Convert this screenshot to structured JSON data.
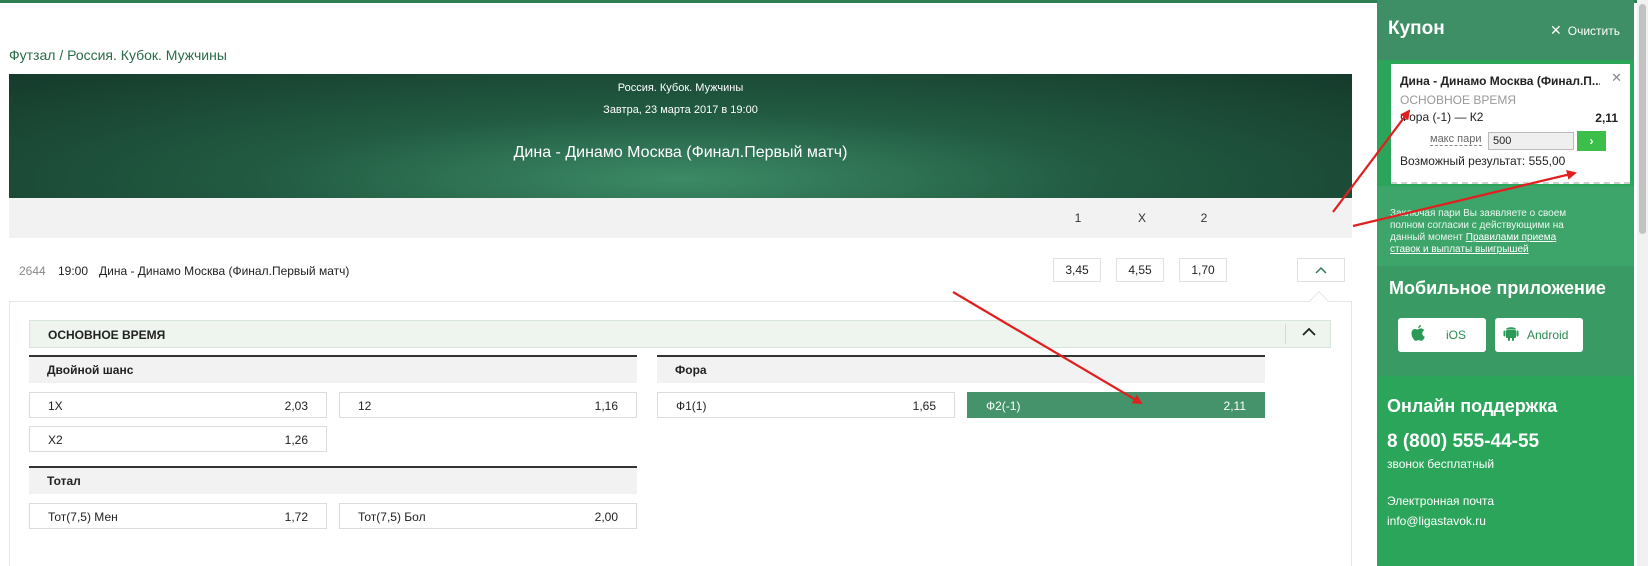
{
  "breadcrumb": "Футзал / Россия. Кубок. Мужчины",
  "banner": {
    "league": "Россия. Кубок. Мужчины",
    "date": "Завтра, 23 марта 2017 в 19:00",
    "title": "Дина - Динамо Москва (Финал.Первый матч)"
  },
  "columns": [
    "1",
    "X",
    "2"
  ],
  "event": {
    "number": "2644",
    "time": "19:00",
    "name": "Дина - Динамо Москва (Финал.Первый матч)",
    "odds": [
      "3,45",
      "4,55",
      "1,70"
    ],
    "collapse_icon": "chevron-up-icon"
  },
  "period": {
    "label": "ОСНОВНОЕ ВРЕМЯ",
    "toggle_icon": "chevron-up-icon"
  },
  "markets": {
    "double_chance": {
      "title": "Двойной шанс",
      "cells": [
        {
          "name": "1X",
          "value": "2,03"
        },
        {
          "name": "12",
          "value": "1,16"
        },
        {
          "name": "X2",
          "value": "1,26"
        }
      ]
    },
    "handicap": {
      "title": "Фора",
      "cells": [
        {
          "name": "Ф1(1)",
          "value": "1,65"
        },
        {
          "name": "Ф2(-1)",
          "value": "2,11",
          "selected": true
        }
      ]
    },
    "total": {
      "title": "Тотал",
      "cells": [
        {
          "name": "Тот(7,5) Мен",
          "value": "1,72"
        },
        {
          "name": "Тот(7,5) Бол",
          "value": "2,00"
        }
      ]
    }
  },
  "coupon": {
    "title": "Купон",
    "clear_label": "Очистить",
    "match": "Дина - Динамо Москва (Финал.П...",
    "period": "ОСНОВНОЕ ВРЕМЯ",
    "market": "Фора (-1) — К2",
    "odd": "2,11",
    "max_label": "макс пари",
    "stake": "500",
    "go_icon": "chevron-right-icon",
    "result": "Возможный результат: 555,00",
    "terms_text": "Заключая пари Вы заявляете о своем полном согласии с действующими на данный момент ",
    "terms_link": "Правилами приема ставок и выплаты выигрышей"
  },
  "mobile": {
    "title": "Мобильное приложение",
    "ios_label": "iOS",
    "android_label": "Android"
  },
  "support": {
    "title": "Онлайн поддержка",
    "phone": "8 (800) 555-44-55",
    "phone_note": "звонок бесплатный",
    "email_label": "Электронная почта",
    "email": "info@ligastavok.ru"
  },
  "colors": {
    "accent": "#2e7d55",
    "selected_cell": "#45936a",
    "sidebar": "#2aa55a",
    "annotation_arrow": "#e02020"
  }
}
